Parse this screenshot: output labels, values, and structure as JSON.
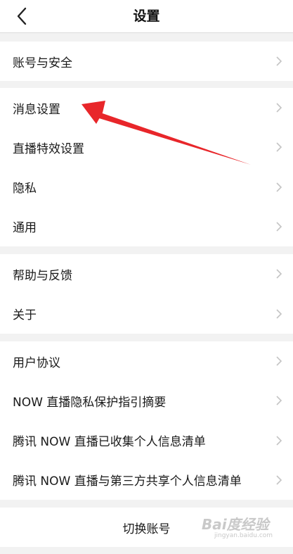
{
  "nav": {
    "title": "设置",
    "back_icon": "chevron-left-icon"
  },
  "groups": [
    {
      "items": [
        {
          "label": "账号与安全"
        }
      ]
    },
    {
      "items": [
        {
          "label": "消息设置"
        },
        {
          "label": "直播特效设置"
        },
        {
          "label": "隐私"
        },
        {
          "label": "通用"
        }
      ]
    },
    {
      "items": [
        {
          "label": "帮助与反馈"
        },
        {
          "label": "关于"
        }
      ]
    },
    {
      "items": [
        {
          "label": "用户协议"
        },
        {
          "label": "NOW 直播隐私保护指引摘要"
        },
        {
          "label": "腾讯 NOW 直播已收集个人信息清单"
        },
        {
          "label": "腾讯 NOW 直播与第三方共享个人信息清单"
        }
      ]
    }
  ],
  "switch_account": {
    "label": "切换账号"
  },
  "annotation": {
    "color": "#e8262a",
    "points_to": "消息设置"
  },
  "watermark": {
    "logo": "Bai度经验",
    "url": "jingyan.baidu.com"
  },
  "colors": {
    "background": "#f2f2f2",
    "card": "#ffffff",
    "chevron": "#c4c4c4"
  }
}
